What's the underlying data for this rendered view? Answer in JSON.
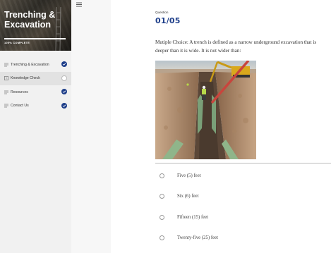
{
  "sidebar": {
    "course_title": "Trenching & Excavation",
    "progress_text": "100% COMPLETE",
    "items": [
      {
        "label": "Trenching & Excavation",
        "status": "complete"
      },
      {
        "label": "Knowledge Check",
        "status": "incomplete"
      },
      {
        "label": "Resources",
        "status": "complete"
      },
      {
        "label": "Contact Us",
        "status": "complete"
      }
    ]
  },
  "menu": {
    "icon": "hamburger-menu-icon"
  },
  "question": {
    "label": "Question",
    "number": "01/05",
    "text": "Mutiple Choice: A trench is defined as a narrow underground excavation that is deeper than it is wide. It is not wider than:",
    "image": "trench-excavation-photo",
    "choices": [
      {
        "label": "Five (5) feet",
        "selected": false
      },
      {
        "label": "Six (6) feet",
        "selected": false
      },
      {
        "label": "Fifteen (15) feet",
        "selected": false
      },
      {
        "label": "Twenty-five (25) feet",
        "selected": false
      }
    ]
  },
  "colors": {
    "accent": "#1f3f8a",
    "sidebar_bg": "#f1f1f1"
  }
}
